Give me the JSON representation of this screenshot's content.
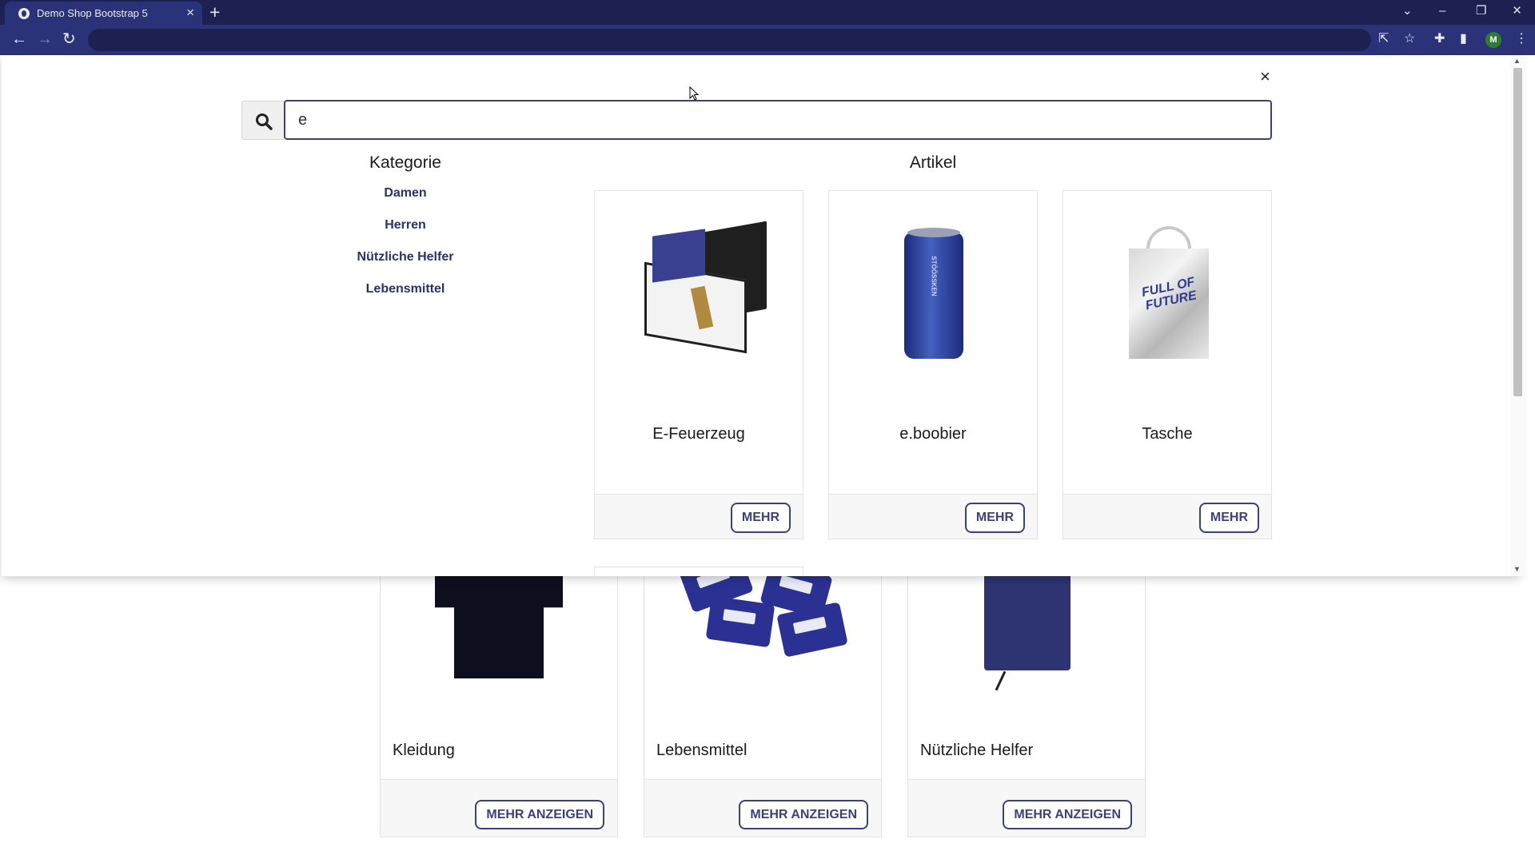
{
  "browser": {
    "tab_title": "Demo Shop Bootstrap 5",
    "tab_close": "×",
    "new_tab": "+",
    "profile_initial": "M",
    "window_controls": {
      "chevron": "⌄",
      "minimize": "–",
      "restore": "❐",
      "close": "×"
    },
    "nav": {
      "back": "←",
      "forward": "→",
      "reload": "↻"
    },
    "toolbar_icons": {
      "share": "⇱",
      "bookmark": "☆",
      "extensions": "✚",
      "sidepanel": "▮",
      "menu": "⋮"
    }
  },
  "search": {
    "value": "e",
    "close_label": "×",
    "categories_heading": "Kategorie",
    "categories": [
      "Damen",
      "Herren",
      "Nützliche Helfer",
      "Lebensmittel"
    ],
    "articles_heading": "Artikel",
    "articles": [
      {
        "name": "E-Feuerzeug",
        "button": "MEHR",
        "image": "lighter-giftbox"
      },
      {
        "name": "e.boobier",
        "button": "MEHR",
        "image": "beer-can"
      },
      {
        "name": "Tasche",
        "button": "MEHR",
        "image": "silver-tote-bag"
      }
    ],
    "bag_print": "FULL OF FUTURE",
    "can_print": "STÖÖSSKEN"
  },
  "background_page": {
    "categories": [
      {
        "title": "Kleidung",
        "button": "MEHR ANZEIGEN",
        "image": "tshirt"
      },
      {
        "title": "Lebensmittel",
        "button": "MEHR ANZEIGEN",
        "image": "candy-packs"
      },
      {
        "title": "Nützliche Helfer",
        "button": "MEHR ANZEIGEN",
        "image": "notebook"
      }
    ]
  },
  "colors": {
    "chrome_dark": "#1c2152",
    "chrome": "#2b3277",
    "accent": "#3b4279",
    "link": "#2b3166"
  }
}
